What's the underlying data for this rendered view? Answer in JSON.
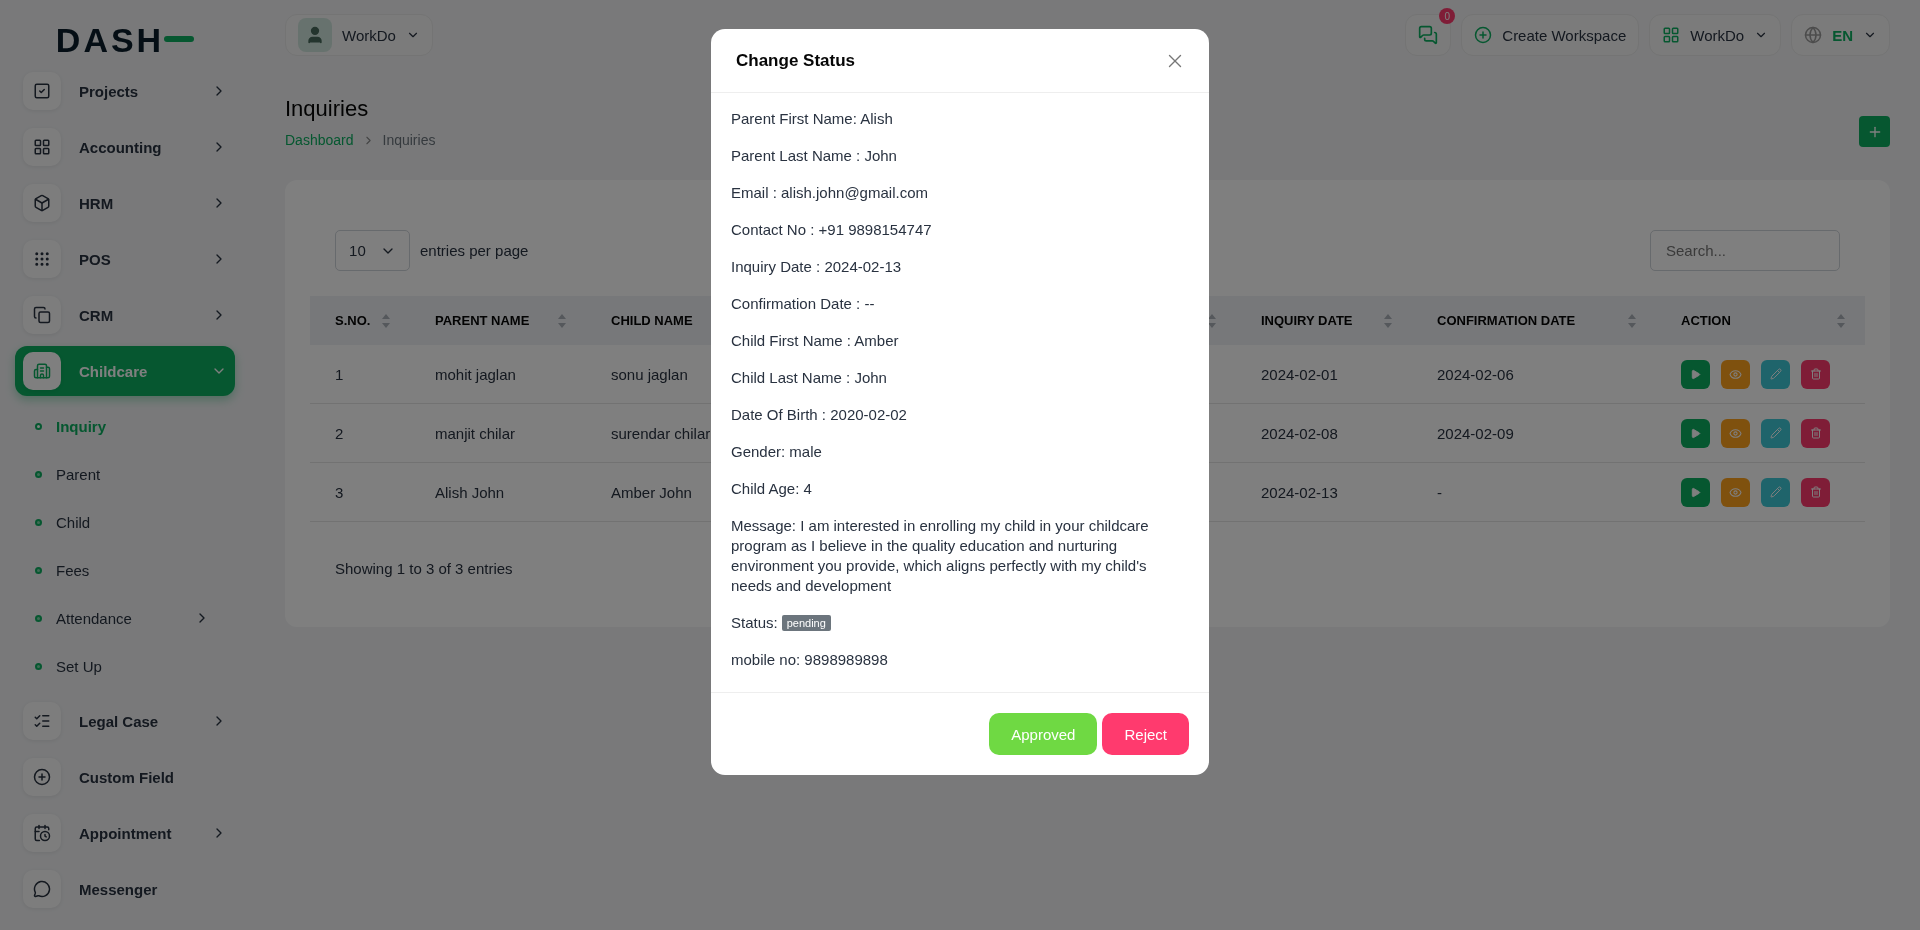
{
  "logo": "DASH",
  "sidebar": {
    "items": [
      {
        "label": "Projects",
        "has_children": true,
        "selected": false
      },
      {
        "label": "Accounting",
        "has_children": true,
        "selected": false
      },
      {
        "label": "HRM",
        "has_children": true,
        "selected": false
      },
      {
        "label": "POS",
        "has_children": true,
        "selected": false
      },
      {
        "label": "CRM",
        "has_children": true,
        "selected": false
      },
      {
        "label": "Childcare",
        "has_children": true,
        "selected": true,
        "expanded": true,
        "children": [
          {
            "label": "Inquiry",
            "selected": true,
            "has_children": false
          },
          {
            "label": "Parent",
            "selected": false,
            "has_children": false
          },
          {
            "label": "Child",
            "selected": false,
            "has_children": false
          },
          {
            "label": "Fees",
            "selected": false,
            "has_children": false
          },
          {
            "label": "Attendance",
            "selected": false,
            "has_children": true
          },
          {
            "label": "Set Up",
            "selected": false,
            "has_children": false
          }
        ]
      },
      {
        "label": "Legal Case",
        "has_children": true,
        "selected": false
      },
      {
        "label": "Custom Field",
        "has_children": false,
        "selected": false
      },
      {
        "label": "Appointment",
        "has_children": true,
        "selected": false
      },
      {
        "label": "Messenger",
        "has_children": false,
        "selected": false
      }
    ]
  },
  "header": {
    "workspace_user": "WorkDo",
    "notification_count": "0",
    "create_workspace": "Create Workspace",
    "workspace": "WorkDo",
    "language": "EN"
  },
  "page": {
    "title": "Inquiries",
    "breadcrumb": [
      "Dashboard",
      "Inquiries"
    ]
  },
  "table": {
    "per_page": "10",
    "per_page_label": "entries per page",
    "search_placeholder": "Search...",
    "columns": [
      "S.NO.",
      "PARENT NAME",
      "CHILD NAME",
      "INQUIRY DATE",
      "CONFIRMATION DATE",
      "ACTION"
    ],
    "rows": [
      {
        "sno": "1",
        "parent": "mohit jaglan",
        "child": "sonu jaglan",
        "inquiry_date": "2024-02-01",
        "confirmation_date": "2024-02-06"
      },
      {
        "sno": "2",
        "parent": "manjit chilar",
        "child": "surendar chilar",
        "inquiry_date": "2024-02-08",
        "confirmation_date": "2024-02-09"
      },
      {
        "sno": "3",
        "parent": "Alish John",
        "child": "Amber John",
        "inquiry_date": "2024-02-13",
        "confirmation_date": "-"
      }
    ],
    "footer": "Showing 1 to 3 of 3 entries"
  },
  "modal": {
    "title": "Change Status",
    "lines": [
      {
        "kind": "text",
        "text": "Parent First Name: Alish"
      },
      {
        "kind": "text",
        "text": "Parent Last Name : John"
      },
      {
        "kind": "text",
        "text": "Email : alish.john@gmail.com"
      },
      {
        "kind": "text",
        "text": "Contact No : +91 9898154747"
      },
      {
        "kind": "text",
        "text": "Inquiry Date : 2024-02-13"
      },
      {
        "kind": "text",
        "text": "Confirmation Date : --"
      },
      {
        "kind": "text",
        "text": "Child First Name : Amber"
      },
      {
        "kind": "text",
        "text": "Child Last Name : John"
      },
      {
        "kind": "text",
        "text": "Date Of Birth : 2020-02-02"
      },
      {
        "kind": "text",
        "text": "Gender: male"
      },
      {
        "kind": "text",
        "text": "Child Age: 4"
      },
      {
        "kind": "text",
        "text": "Message: I am interested in enrolling my child in your childcare program as I believe in the quality education and nurturing environment you provide, which aligns perfectly with my child's needs and development"
      },
      {
        "kind": "badge",
        "text": "Status:",
        "badge": "pending"
      },
      {
        "kind": "text",
        "text": "mobile no: 9898989898"
      }
    ],
    "buttons": [
      {
        "label": "Approved",
        "kind": "approve"
      },
      {
        "label": "Reject",
        "kind": "reject"
      }
    ]
  }
}
